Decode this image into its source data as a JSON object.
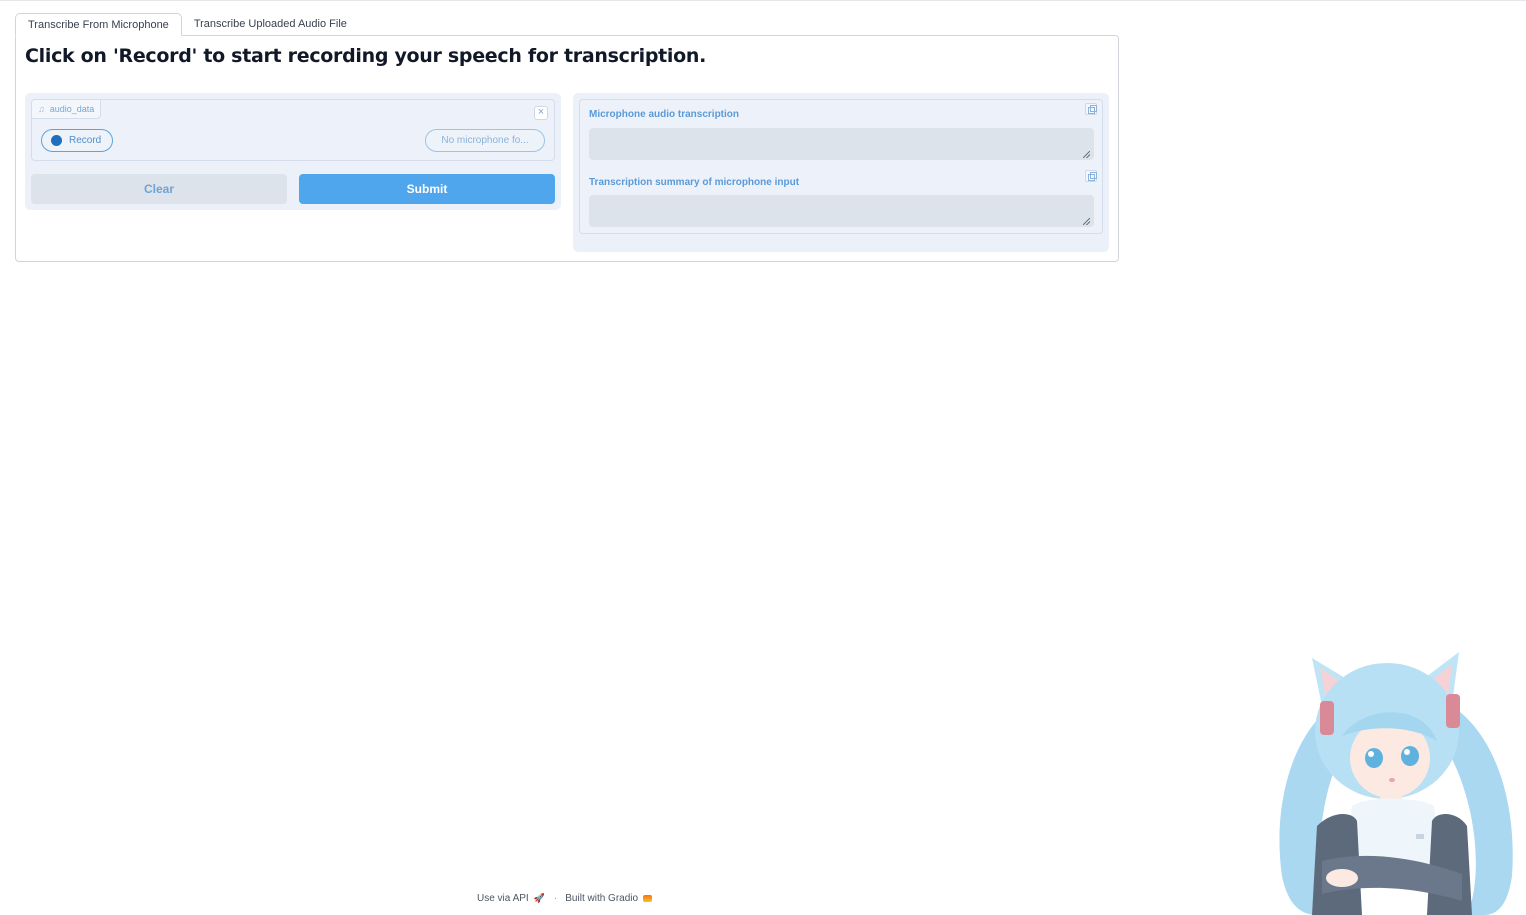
{
  "tabs": [
    {
      "label": "Transcribe From Microphone",
      "active": true
    },
    {
      "label": "Transcribe Uploaded Audio File",
      "active": false
    }
  ],
  "headline": "Click on 'Record' to start recording your speech for transcription.",
  "audio": {
    "label": "audio_data",
    "icon": "music-icon",
    "record_label": "Record",
    "microphone_select": "No microphone fo..."
  },
  "buttons": {
    "clear": "Clear",
    "submit": "Submit"
  },
  "outputs": {
    "transcription_label": "Microphone audio transcription",
    "transcription_value": "",
    "summary_label": "Transcription summary of microphone input",
    "summary_value": ""
  },
  "footer": {
    "api_label": "Use via API",
    "separator": "·",
    "built_label": "Built with Gradio"
  },
  "colors": {
    "accent": "#4fa6ed",
    "panel_bg": "#ecf1f9",
    "label_blue": "#5a9ad7"
  }
}
